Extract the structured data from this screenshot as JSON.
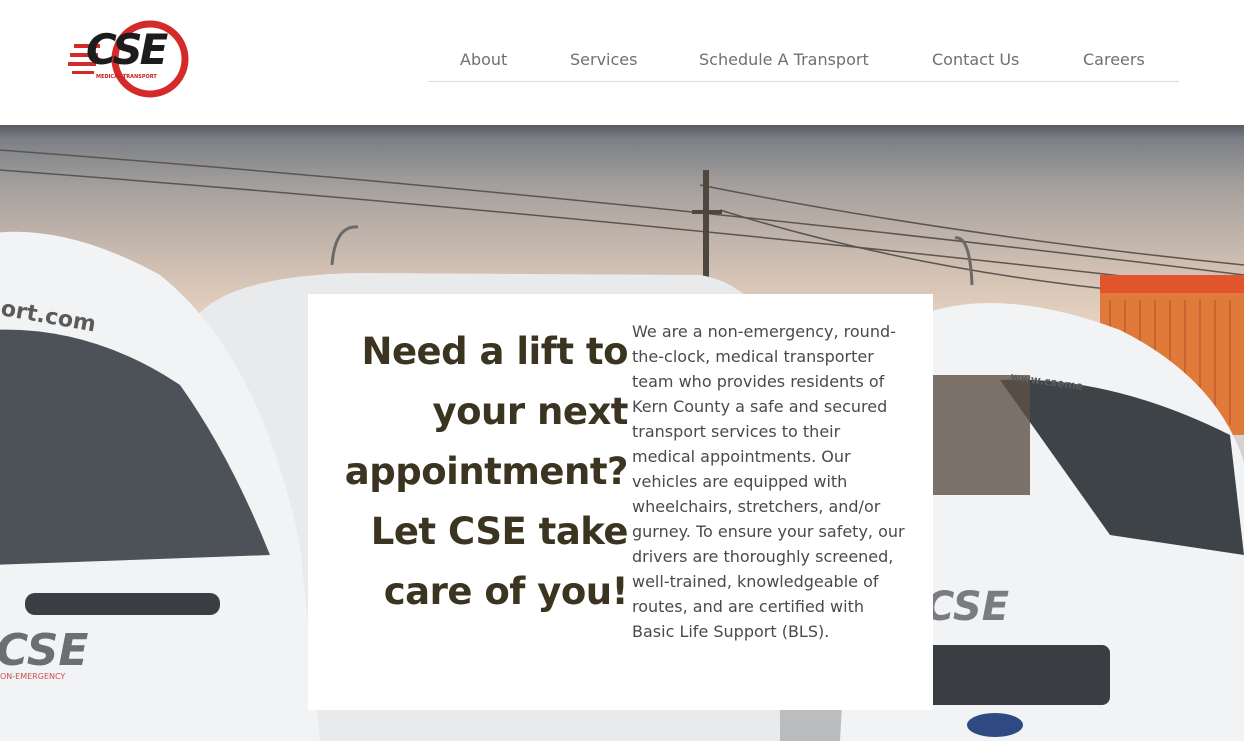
{
  "brand": {
    "logo_text": "CSE",
    "logo_subtext": "MEDICAL TRANSPORT",
    "colors": {
      "primary_red": "#d42a2a",
      "dark": "#1c1c1c"
    }
  },
  "nav": {
    "items": [
      {
        "label": "About"
      },
      {
        "label": "Services"
      },
      {
        "label": "Schedule A Transport"
      },
      {
        "label": "Contact Us"
      },
      {
        "label": "Careers"
      }
    ]
  },
  "hero": {
    "van_text_left": "ort.com",
    "van_text_right": "www.cseme",
    "van_badge": "CSE",
    "van_subbadge": "ON-EMERGENCY"
  },
  "card": {
    "headline": "Need a lift to\nyour next\nappointment?\nLet CSE take\ncare of you!",
    "description": "We are a non-emergency, round-the-clock, medical transporter team who provides residents of Kern County a safe and secured transport services to their medical appointments. Our vehicles are equipped with wheelchairs, stretchers, and/or gurney. To ensure your safety, our drivers are thoroughly screened, well-trained, knowledgeable of routes, and are certified with Basic Life Support (BLS).",
    "colors": {
      "headline": "#3b3420",
      "body": "#4a4a4a"
    }
  }
}
